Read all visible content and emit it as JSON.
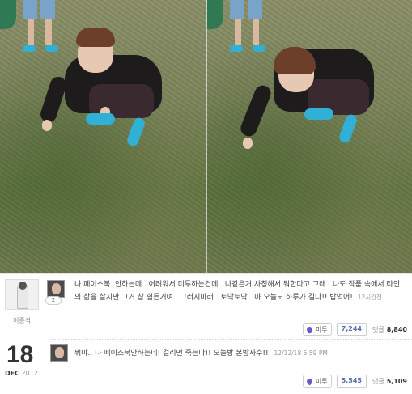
{
  "post": {
    "author": "이종석",
    "avatar_badge": "2",
    "text": "나 페이스북..안하는데.. 어려워서 미투하는건데.. 나같은거 사칭해서 뭐한다고 그래.. 나도 작품 속에서 타인의 삶을 살지만 그거 참 힘든거여.. 그러지마러.. 토닥토닥.. 아 오늘도 하루가 길다!! 밥먹어!",
    "time": "12시간전",
    "metoo_label": "미투",
    "metoo_count": "7,244",
    "reply_label": "댓글",
    "reply_count": "8,840"
  },
  "date": {
    "day": "18",
    "month": "DEC",
    "year": "2012"
  },
  "reply": {
    "text": "뭐야.. 나 페이스북안하는데! 걸리면 죽는다!! 오늘밤 본방사수!!",
    "time": "12/12/18 6:59 PM",
    "metoo_label": "미투",
    "metoo_count": "5,545",
    "reply_label": "댓글",
    "reply_count": "5,109"
  },
  "colors": {
    "grass": "#6c7a4c",
    "shoe": "#2fb0d4",
    "count_text": "#5a6fb0"
  },
  "icons": [
    "metoo-pin-icon"
  ]
}
